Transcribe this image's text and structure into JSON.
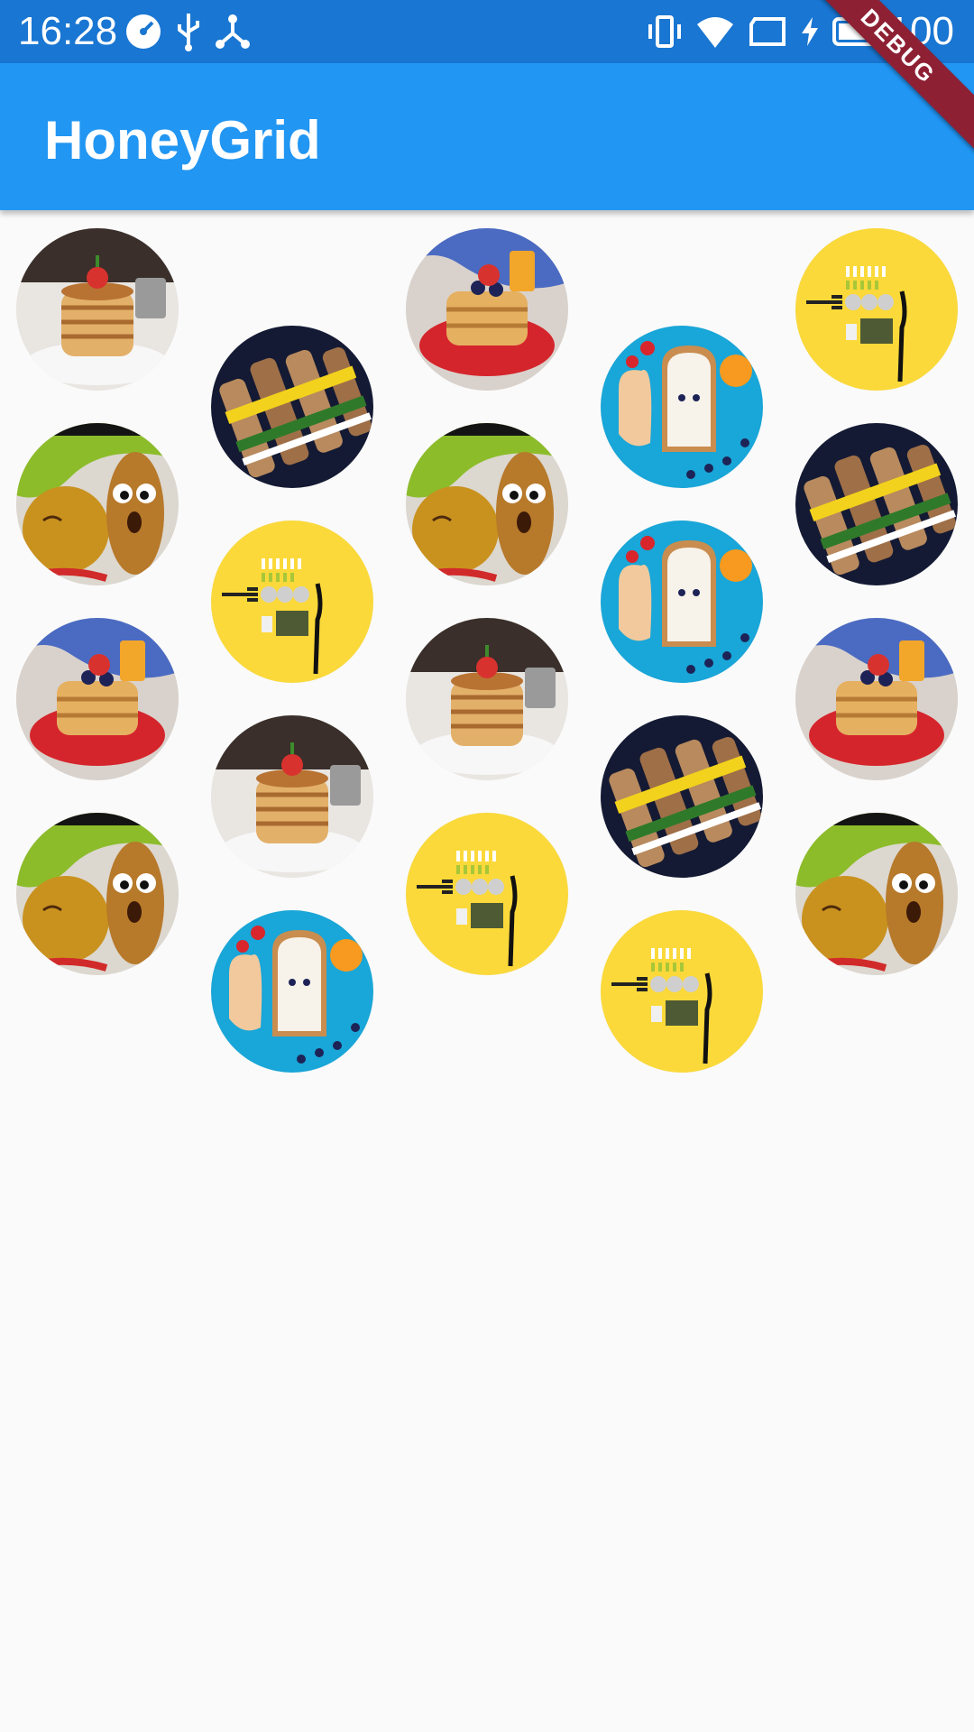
{
  "status_bar": {
    "time": "16:28",
    "battery_level": "100",
    "left_icons": [
      "speedometer-icon",
      "usb-icon",
      "network-icon"
    ],
    "right_icons": [
      "vibrate-icon",
      "wifi-icon",
      "sim-card-icon",
      "charging-icon",
      "battery-icon"
    ],
    "background": "#1976d2"
  },
  "app_bar": {
    "title": "HoneyGrid",
    "background": "#2196f3"
  },
  "debug_banner": "DEBUG",
  "grid": {
    "items": [
      {
        "image": "pancakes"
      },
      {
        "image": "skewers"
      },
      {
        "image": "waffles"
      },
      {
        "image": "toast"
      },
      {
        "image": "cutlery"
      },
      {
        "image": "potatoes"
      },
      {
        "image": "cutlery"
      },
      {
        "image": "potatoes"
      },
      {
        "image": "toast"
      },
      {
        "image": "skewers"
      },
      {
        "image": "waffles"
      },
      {
        "image": "pancakes"
      },
      {
        "image": "pancakes"
      },
      {
        "image": "skewers"
      },
      {
        "image": "waffles"
      },
      {
        "image": "potatoes"
      },
      {
        "image": "toast"
      },
      {
        "image": "cutlery"
      },
      {
        "image": "cutlery"
      },
      {
        "image": "potatoes"
      }
    ]
  }
}
